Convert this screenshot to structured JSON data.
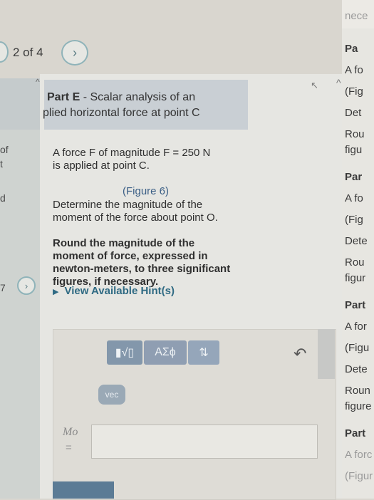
{
  "nav": {
    "position": "2 of 4",
    "next_icon": "chevron-right-icon"
  },
  "left_fragments": [
    "of",
    "t",
    "d",
    "7"
  ],
  "part": {
    "label": "Part E",
    "title_rest": " - Scalar analysis of an",
    "title_line2": "plied horizontal force at point C"
  },
  "problem": {
    "line1": "A force F of magnitude F = 250 N",
    "line2": "is applied at point C.",
    "figure_link": "(Figure 6)",
    "determine_line1": "Determine the magnitude of the",
    "determine_line2": "moment of the force about point O.",
    "round_line1": "Round the magnitude of the",
    "round_line2": "moment of force, expressed in",
    "round_line3": "newton-meters, to three significant",
    "round_line4": "figures, if necessary."
  },
  "hints": {
    "label": "View Available Hint(s)"
  },
  "toolbar": {
    "template_icon": "radical-template-icon",
    "greek_label": "ΑΣϕ",
    "sort_icon": "arrows-updown-icon",
    "undo_icon": "undo-arrow-icon",
    "vec_label": "vec"
  },
  "answer": {
    "label": "Mo",
    "equals": "=",
    "value": ""
  },
  "right_panel": [
    {
      "text": "nece",
      "style": "faded"
    },
    {
      "text": "Pa",
      "style": "bold"
    },
    {
      "text": "A fo",
      "style": "normal"
    },
    {
      "text": "(Fig",
      "style": "normal"
    },
    {
      "text": "Det",
      "style": "normal"
    },
    {
      "text": "Rou",
      "style": "normal"
    },
    {
      "text": "figu",
      "style": "normal"
    },
    {
      "text": "Par",
      "style": "bold"
    },
    {
      "text": "A fo",
      "style": "normal"
    },
    {
      "text": "(Fig",
      "style": "normal"
    },
    {
      "text": "Dete",
      "style": "normal"
    },
    {
      "text": "Rou",
      "style": "normal"
    },
    {
      "text": "figur",
      "style": "normal"
    },
    {
      "text": "Part",
      "style": "bold"
    },
    {
      "text": "A for",
      "style": "normal"
    },
    {
      "text": "(Figu",
      "style": "normal"
    },
    {
      "text": "Dete",
      "style": "normal"
    },
    {
      "text": "Roun",
      "style": "normal"
    },
    {
      "text": "figure",
      "style": "normal"
    },
    {
      "text": "Part",
      "style": "bold"
    },
    {
      "text": "A forc",
      "style": "faded"
    },
    {
      "text": "(Figur",
      "style": "faded"
    }
  ],
  "colors": {
    "accent": "#2f6a83",
    "toolbar_button": "#8397ab",
    "header_box": "#c9cfd4",
    "submit": "#5b7b95"
  }
}
